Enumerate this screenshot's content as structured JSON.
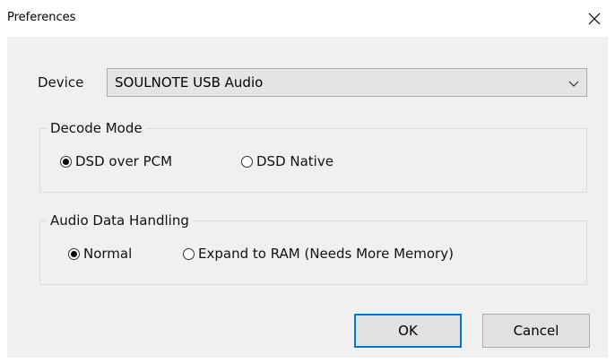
{
  "window": {
    "title": "Preferences",
    "close_icon": "close-icon"
  },
  "device": {
    "label": "Device",
    "selected": "SOULNOTE USB Audio"
  },
  "decode_mode": {
    "title": "Decode Mode",
    "options": [
      {
        "label": "DSD over PCM",
        "checked": true
      },
      {
        "label": "DSD Native",
        "checked": false
      }
    ]
  },
  "audio_data_handling": {
    "title": "Audio Data Handling",
    "options": [
      {
        "label": "Normal",
        "checked": true
      },
      {
        "label": "Expand to RAM (Needs More Memory)",
        "checked": false
      }
    ]
  },
  "buttons": {
    "ok": "OK",
    "cancel": "Cancel"
  },
  "colors": {
    "default_button_border": "#0078d7",
    "dialog_background": "#f0f0f0"
  }
}
